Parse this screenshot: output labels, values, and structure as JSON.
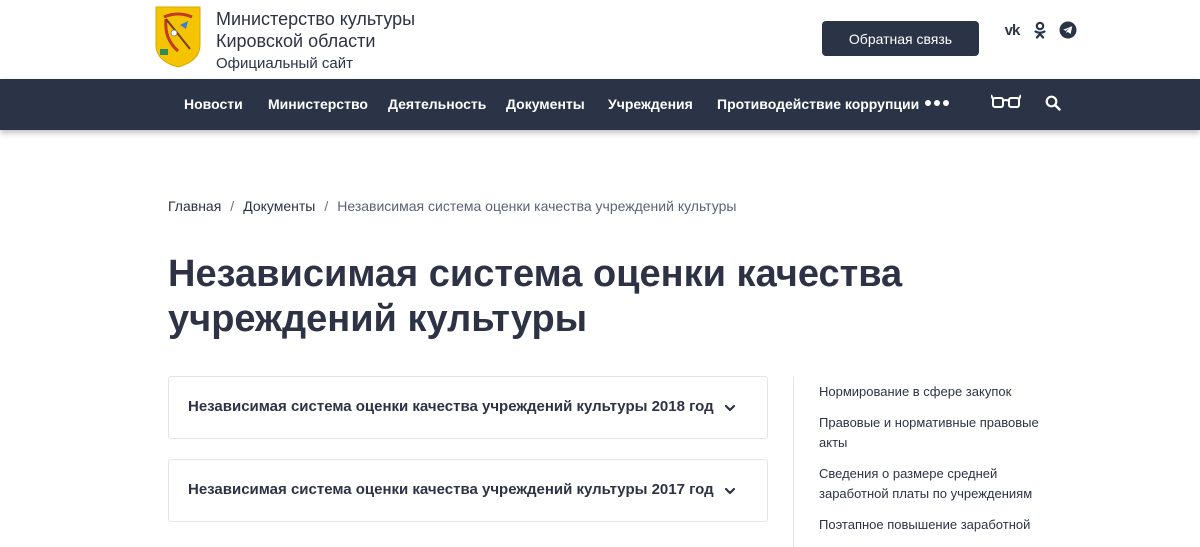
{
  "header": {
    "title_line1": "Министерство культуры",
    "title_line2": "Кировской области",
    "subtitle": "Официальный сайт",
    "feedback_button": "Обратная связь",
    "socials": [
      "vk-icon",
      "odnoklassniki-icon",
      "telegram-icon"
    ]
  },
  "nav": {
    "items": [
      {
        "label": "Новости"
      },
      {
        "label": "Министерство"
      },
      {
        "label": "Деятельность"
      },
      {
        "label": "Документы"
      },
      {
        "label": "Учреждения"
      },
      {
        "label": "Противодействие коррупции"
      }
    ],
    "icons": [
      "more-icon",
      "glasses-icon",
      "search-icon"
    ]
  },
  "breadcrumb": {
    "items": [
      "Главная",
      "Документы",
      "Независимая система оценки качества учреждений культуры"
    ],
    "separator": "/"
  },
  "page": {
    "title_line1": "Независимая система оценки качества",
    "title_line2": "учреждений культуры"
  },
  "accordions": [
    {
      "title": "Независимая система оценки качества учреждений культуры 2018 год"
    },
    {
      "title": "Независимая система оценки качества учреждений культуры 2017 год"
    }
  ],
  "sidebar": {
    "links": [
      {
        "line1": "Нормирование в сфере закупок",
        "line2": ""
      },
      {
        "line1": "Правовые и нормативные правовые",
        "line2": "акты"
      },
      {
        "line1": "Сведения о размере средней",
        "line2": "заработной платы по учреждениям"
      },
      {
        "line1": "Поэтапное повышение заработной",
        "line2": ""
      }
    ]
  },
  "colors": {
    "navbar": "#2b3447",
    "text": "#2d3345",
    "border": "#e3e5ea"
  }
}
